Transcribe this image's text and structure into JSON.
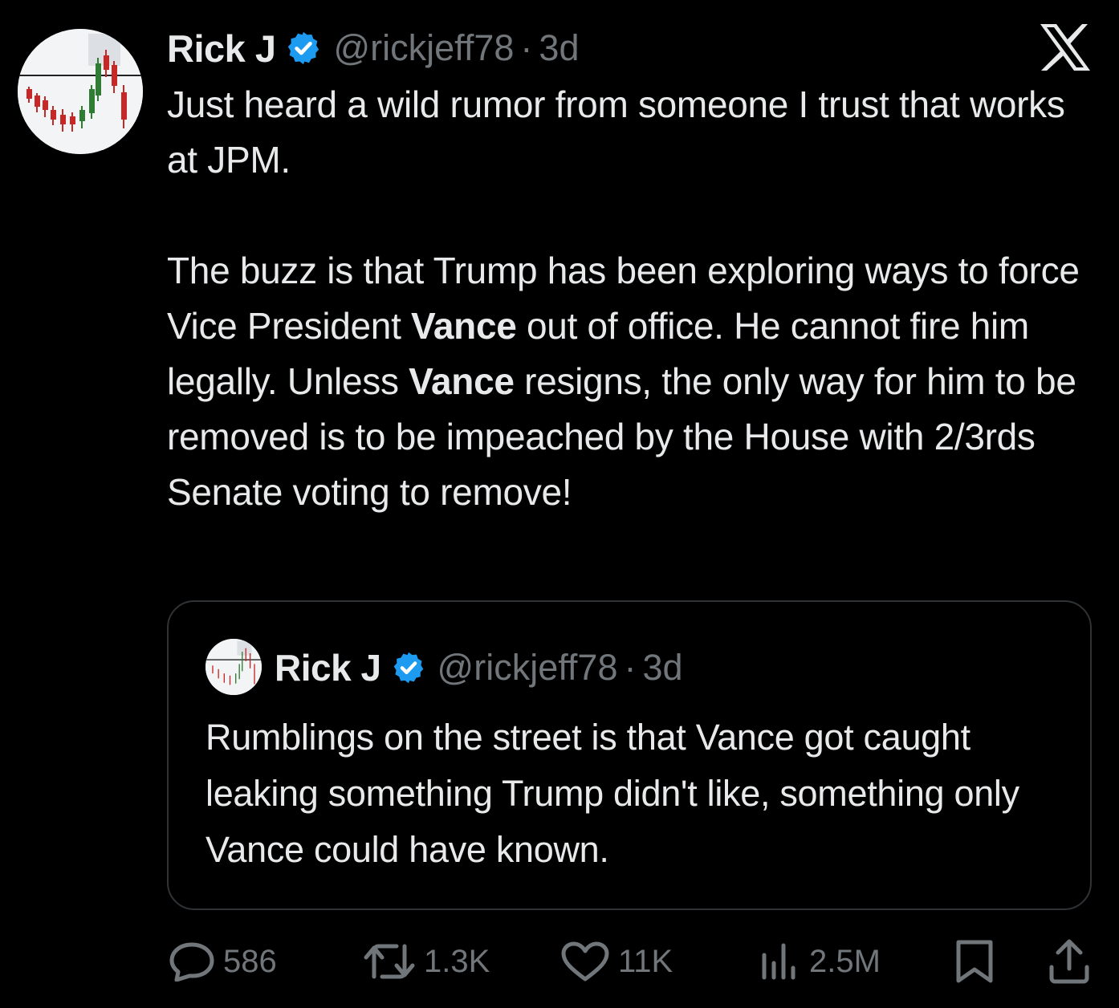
{
  "tweet": {
    "author_name": "Rick J",
    "handle": "@rickjeff78",
    "separator": "·",
    "time": "3d",
    "paragraph1": "Just heard a wild rumor from someone I trust that works at JPM.",
    "p2_part1": "The buzz is that Trump has been exploring ways to force Vice President ",
    "p2_bold1": "Vance",
    "p2_part2": " out of office. He cannot fire him legally. Unless ",
    "p2_bold2": "Vance",
    "p2_part3": " resigns, the only way for him to be removed is to be impeached by the House with 2/3rds Senate voting to remove!"
  },
  "quote": {
    "author_name": "Rick J",
    "handle": "@rickjeff78",
    "separator": "·",
    "time": "3d",
    "text": "Rumblings on the street is that Vance got caught leaking something Trump didn't like, something only Vance could have known."
  },
  "actions": {
    "replies": "586",
    "reposts": "1.3K",
    "likes": "11K",
    "views": "2.5M"
  },
  "icons": {
    "verified": "verified-badge-icon",
    "brand": "x-logo-icon",
    "reply": "reply-icon",
    "repost": "repost-icon",
    "like": "heart-icon",
    "views": "views-icon",
    "bookmark": "bookmark-icon",
    "share": "share-icon"
  },
  "colors": {
    "background": "#000000",
    "text": "#e7e9ea",
    "muted": "#71767b",
    "verified": "#1d9bf0",
    "border": "#2f3336"
  }
}
